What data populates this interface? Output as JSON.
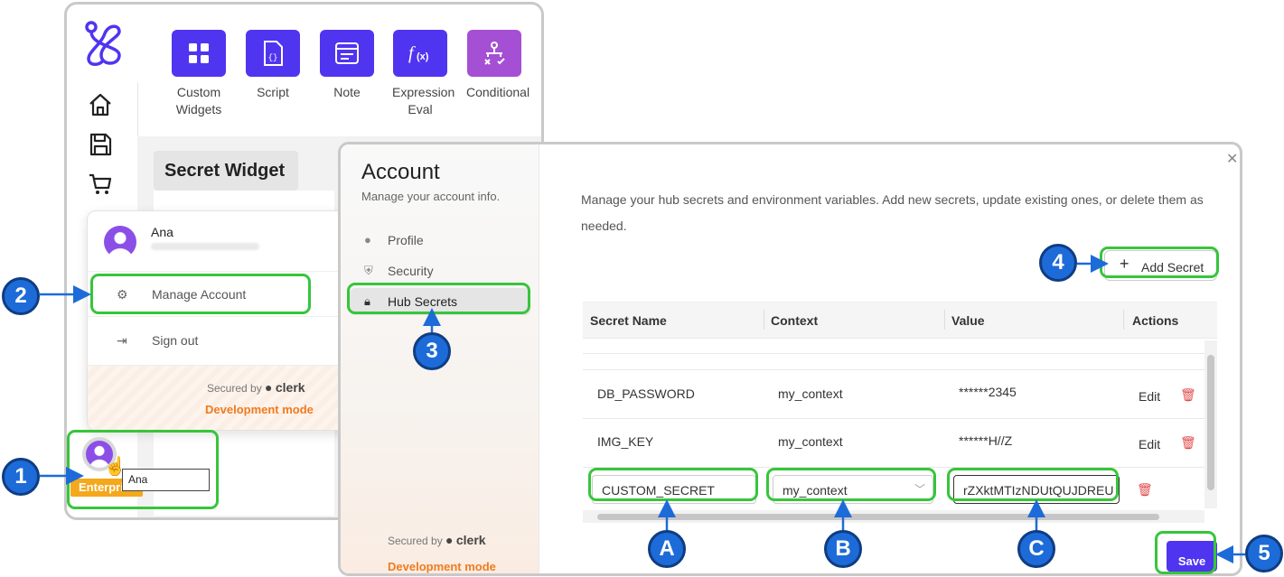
{
  "widgets": [
    {
      "label": "Custom Widgets",
      "icon": "grid-icon"
    },
    {
      "label": "Script",
      "icon": "script-file-icon"
    },
    {
      "label": "Note",
      "icon": "note-icon"
    },
    {
      "label": "Expression Eval",
      "icon": "function-icon"
    },
    {
      "label": "Conditional",
      "icon": "branch-icon"
    }
  ],
  "canvas": {
    "widget_title": "Secret Widget"
  },
  "user_menu": {
    "name": "Ana",
    "manage_account": "Manage Account",
    "sign_out": "Sign out",
    "secured_by": "Secured by",
    "clerk": "clerk",
    "dev_mode": "Development mode"
  },
  "user_badge": {
    "plan": "Enterprise",
    "tooltip": "Ana"
  },
  "account": {
    "title": "Account",
    "subtitle": "Manage your account info.",
    "nav": [
      {
        "label": "Profile",
        "icon": "user-circle-icon"
      },
      {
        "label": "Security",
        "icon": "shield-icon"
      },
      {
        "label": "Hub Secrets",
        "icon": "lock-icon",
        "active": true
      }
    ],
    "secured_by": "Secured by",
    "clerk": "clerk",
    "dev_mode": "Development mode",
    "description": "Manage your hub secrets and environment variables. Add new secrets, update existing ones, or delete them as needed.",
    "add_secret": "Add Secret",
    "save": "Save"
  },
  "table": {
    "headers": [
      "Secret Name",
      "Context",
      "Value",
      "Actions"
    ],
    "rows": [
      {
        "name": "DB_PASSWORD",
        "context": "my_context",
        "value": "******2345",
        "edit": "Edit"
      },
      {
        "name": "IMG_KEY",
        "context": "my_context",
        "value": "******H//Z",
        "edit": "Edit"
      }
    ],
    "new_row": {
      "name": "CUSTOM_SECRET",
      "context": "my_context",
      "value": "rZXktMTIzNDUtQUJDREU"
    }
  },
  "callouts": [
    "1",
    "2",
    "3",
    "4",
    "5",
    "A",
    "B",
    "C"
  ],
  "colors": {
    "accent": "#4f35f0",
    "conditional": "#a54fd4",
    "highlight": "#37c53b",
    "badge": "#1d6bd8",
    "enterprise": "#f4a81c",
    "dev_mode": "#f07b1f",
    "delete": "#e04848"
  }
}
